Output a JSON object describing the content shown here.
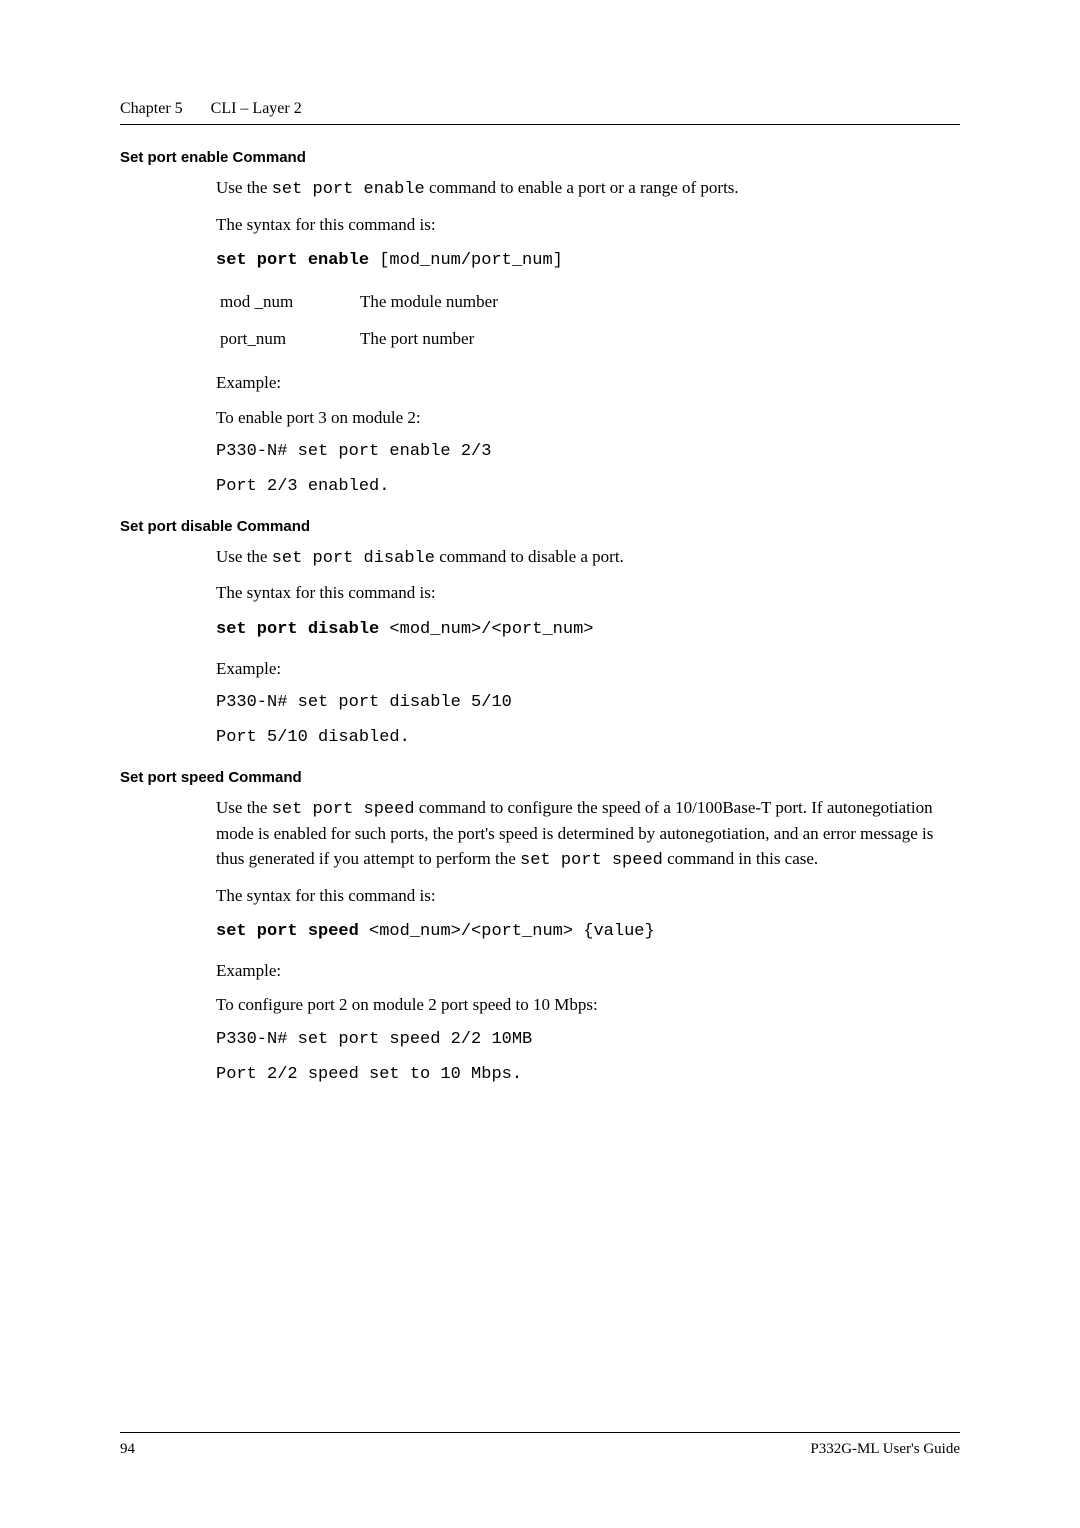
{
  "header": {
    "chapter": "Chapter 5",
    "title": "CLI – Layer 2"
  },
  "sections": {
    "enable": {
      "title": "Set port enable Command",
      "intro_a": "Use the ",
      "intro_cmd": "set port enable",
      "intro_b": " command to enable a port or a range of ports.",
      "syntax_label": "The syntax for this command is:",
      "syntax_bold": "set port enable",
      "syntax_args": " [mod_num/port_num]",
      "params": [
        {
          "name": "mod _num",
          "desc": "The module number"
        },
        {
          "name": "port_num",
          "desc": "The port number"
        }
      ],
      "example_label": "Example:",
      "example_desc": "To enable port 3 on module 2:",
      "example_cmd": "P330-N# set port enable 2/3",
      "example_out": "Port 2/3 enabled."
    },
    "disable": {
      "title": "Set port disable Command",
      "intro_a": "Use the ",
      "intro_cmd": "set port disable",
      "intro_b": " command to disable a port.",
      "syntax_label": "The syntax for this command is:",
      "syntax_bold": "set port disable",
      "syntax_args": " <mod_num>/<port_num>",
      "example_label": "Example:",
      "example_cmd": "P330-N# set port disable 5/10",
      "example_out": "Port 5/10 disabled."
    },
    "speed": {
      "title": "Set port speed Command",
      "intro_a": "Use the ",
      "intro_cmd": "set port speed",
      "intro_b": " command to configure the speed of a 10/100Base-T port. If autonegotiation mode is enabled for such ports, the port's speed is determined by autonegotiation, and an error message is thus generated if you attempt to perform the ",
      "intro_cmd2": "set port speed",
      "intro_c": " command in this case.",
      "syntax_label": "The syntax for this command is:",
      "syntax_bold": "set port speed",
      "syntax_args": " <mod_num>/<port_num> {value}",
      "example_label": "Example:",
      "example_desc": "To configure port 2 on module 2 port speed to 10 Mbps:",
      "example_cmd": "P330-N# set port speed 2/2 10MB",
      "example_out": "Port 2/2 speed set to 10 Mbps."
    }
  },
  "footer": {
    "page": "94",
    "guide": "P332G-ML User's Guide"
  }
}
